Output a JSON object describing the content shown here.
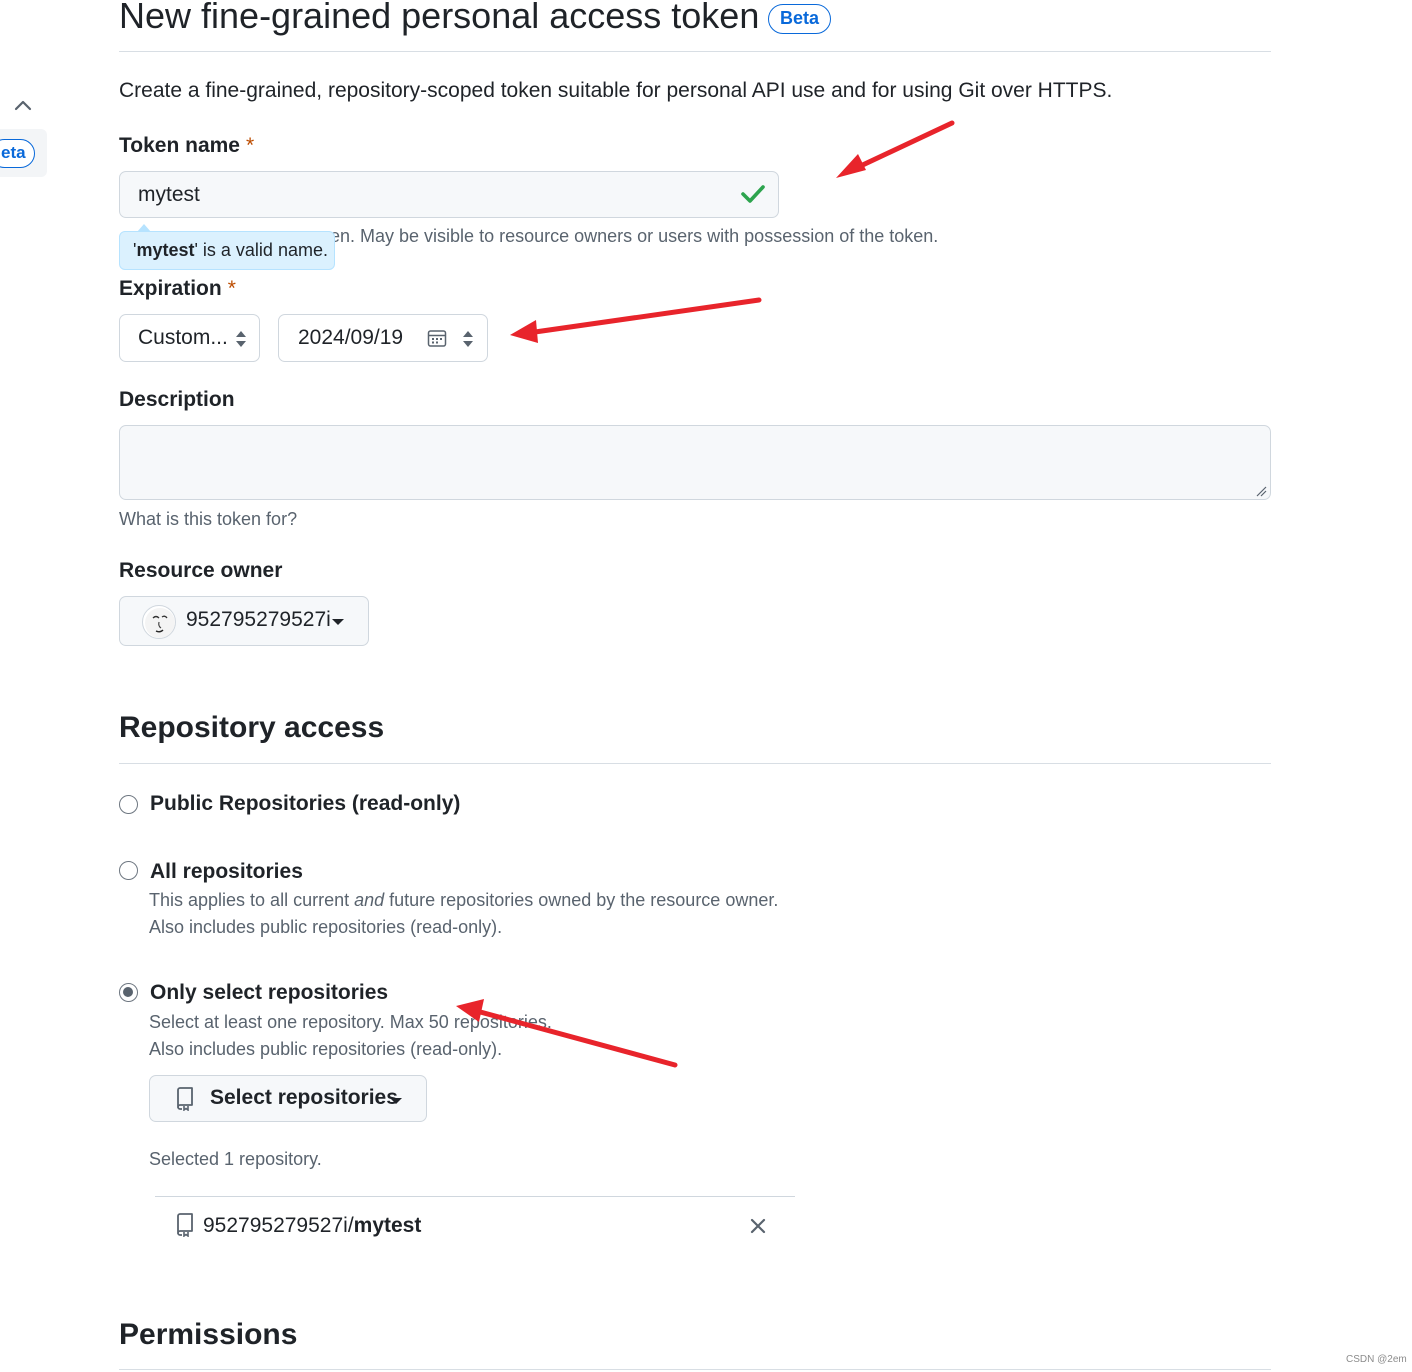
{
  "page": {
    "title": "New fine-grained personal access token",
    "title_badge": "Beta",
    "intro": "Create a fine-grained, repository-scoped token suitable for personal API use and for using Git over HTTPS."
  },
  "sidebar": {
    "badge_partial": "eta"
  },
  "token_name": {
    "label": "Token name",
    "required_mark": "*",
    "value": "mytest",
    "help_visible": "en. May be visible to resource owners or users with possession of the token.",
    "validation_name": "mytest",
    "validation_rest": "' is a valid name.",
    "validation_quote": "'"
  },
  "expiration": {
    "label": "Expiration",
    "required_mark": "*",
    "preset_value": "Custom...",
    "date_value": "2024/09/19"
  },
  "description": {
    "label": "Description",
    "value": "",
    "help": "What is this token for?"
  },
  "resource_owner": {
    "label": "Resource owner",
    "value": "952795279527i"
  },
  "repository_access": {
    "heading": "Repository access",
    "options": [
      {
        "label": "Public Repositories (read-only)",
        "checked": false
      },
      {
        "label": "All repositories",
        "checked": false,
        "desc_pre": "This applies to all current ",
        "desc_em": "and",
        "desc_post": " future repositories owned by the resource owner.",
        "desc2": "Also includes public repositories (read-only)."
      },
      {
        "label": "Only select repositories",
        "checked": true,
        "desc1": "Select at least one repository. Max 50 repositories.",
        "desc2": "Also includes public repositories (read-only)."
      }
    ],
    "select_button": "Select repositories",
    "selected_count": "Selected 1 repository.",
    "selected_repo_owner": "952795279527i/",
    "selected_repo_name": "mytest"
  },
  "permissions": {
    "heading": "Permissions"
  },
  "annotation_color": "#e8242b",
  "accent_color": "#0969da",
  "watermark": "CSDN @2em"
}
